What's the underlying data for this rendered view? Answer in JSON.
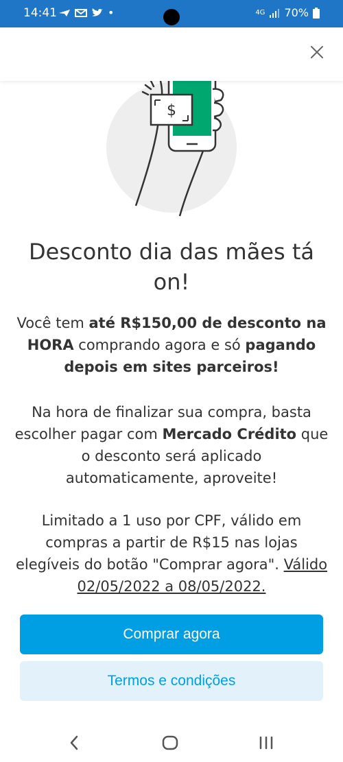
{
  "status_bar": {
    "time": "14:41",
    "dot": "•",
    "network": "4G",
    "battery": "70%"
  },
  "title": "Desconto dia das mães tá on!",
  "p1": {
    "t1": "Você tem ",
    "b1": "até R$150,00 de desconto na HORA",
    "t2": " comprando agora e só ",
    "b2": "pagando depois em sites parceiros!"
  },
  "p2": {
    "t1": "Na hora de finalizar sua compra, basta escolher pagar com ",
    "b1": "Mercado Crédito",
    "t2": " que o desconto será aplicado automaticamente, aproveite!"
  },
  "p3": {
    "text": "Limitado a 1 uso por CPF, válido em compras a partir de R$15 nas lojas elegíveis do botão \"Comprar agora\".",
    "validity": "Válido 02/05/2022 a 08/05/2022."
  },
  "buttons": {
    "primary": "Comprar agora",
    "secondary": "Termos e condições"
  },
  "icons": {
    "close": "close-icon",
    "back": "back-icon",
    "home": "home-icon",
    "recents": "recents-icon"
  },
  "colors": {
    "status_bar": "#1f76c7",
    "accent": "#009ee3",
    "secondary_bg": "#e3f1fb",
    "phone_screen": "#00a870",
    "text": "#333333"
  }
}
